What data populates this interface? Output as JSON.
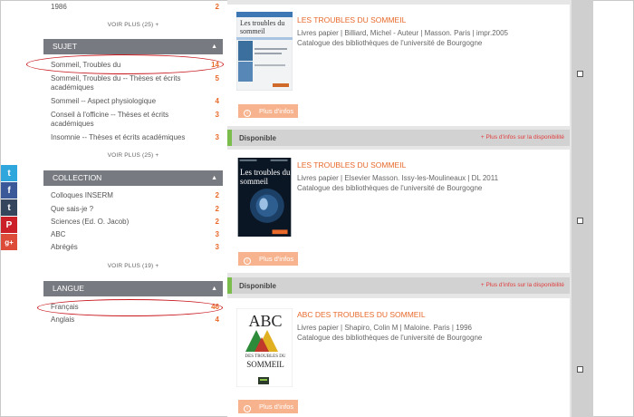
{
  "social": {
    "twitter": "t",
    "facebook": "f",
    "tumblr": "t",
    "pinterest": "P",
    "googleplus": "g+"
  },
  "facets": {
    "top_row": {
      "label": "1986",
      "count": "2"
    },
    "top_more": "VOIR PLUS (25)  +",
    "sujet": {
      "title": "SUJET",
      "items": [
        {
          "label": "Sommeil, Troubles du",
          "count": "14"
        },
        {
          "label": "Sommeil, Troubles du -- Thèses et écrits académiques",
          "count": "5"
        },
        {
          "label": "Sommeil -- Aspect physiologique",
          "count": "4"
        },
        {
          "label": "Conseil à l'officine -- Thèses et écrits académiques",
          "count": "3"
        },
        {
          "label": "Insomnie -- Thèses et écrits académiques",
          "count": "3"
        }
      ],
      "more": "VOIR PLUS (25)  +"
    },
    "collection": {
      "title": "COLLECTION",
      "items": [
        {
          "label": "Colloques INSERM",
          "count": "2"
        },
        {
          "label": "Que sais-je ?",
          "count": "2"
        },
        {
          "label": "Sciences (Ed. O. Jacob)",
          "count": "2"
        },
        {
          "label": "ABC",
          "count": "3"
        },
        {
          "label": "Abrégés",
          "count": "3"
        }
      ],
      "more": "VOIR PLUS (19)  +"
    },
    "langue": {
      "title": "LANGUE",
      "items": [
        {
          "label": "Français",
          "count": "46"
        },
        {
          "label": "Anglais",
          "count": "4"
        }
      ]
    },
    "caret": "▲"
  },
  "results": [
    {
      "title": "LES TROUBLES DU SOMMEIL",
      "meta": "Livres papier | Billiard, Michel - Auteur | Masson. Paris | impr.2005",
      "catalog": "Catalogue des bibliothèques de l'université de Bourgogne",
      "cover_title": "Les troubles du sommeil",
      "info": "Plus d'infos",
      "availability": "Disponible",
      "availability_link": "+ Plus d'infos sur la disponibilité"
    },
    {
      "title": "LES TROUBLES DU SOMMEIL",
      "meta": "Livres papier | Elsevier Masson. Issy-les-Moulineaux | DL 2011",
      "catalog": "Catalogue des bibliothèques de l'université de Bourgogne",
      "cover_title": "Les troubles du sommeil",
      "info": "Plus d'infos",
      "availability": "Disponible",
      "availability_link": "+ Plus d'infos sur la disponibilité"
    },
    {
      "title": "ABC DES TROUBLES DU SOMMEIL",
      "meta": "Livres papier | Shapiro, Colin M | Maloine. Paris | 1996",
      "catalog": "Catalogue des bibliothèques de l'université de Bourgogne",
      "cover_title": "ABC",
      "cover_sub1": "DES TROUBLES DU",
      "cover_sub2": "SOMMEIL",
      "info": "Plus d'infos"
    }
  ],
  "info_icon": "i",
  "colors": {
    "accent": "#e8692a",
    "header": "#777a80",
    "available": "#7bbd4d",
    "highlight": "#c8181e"
  }
}
